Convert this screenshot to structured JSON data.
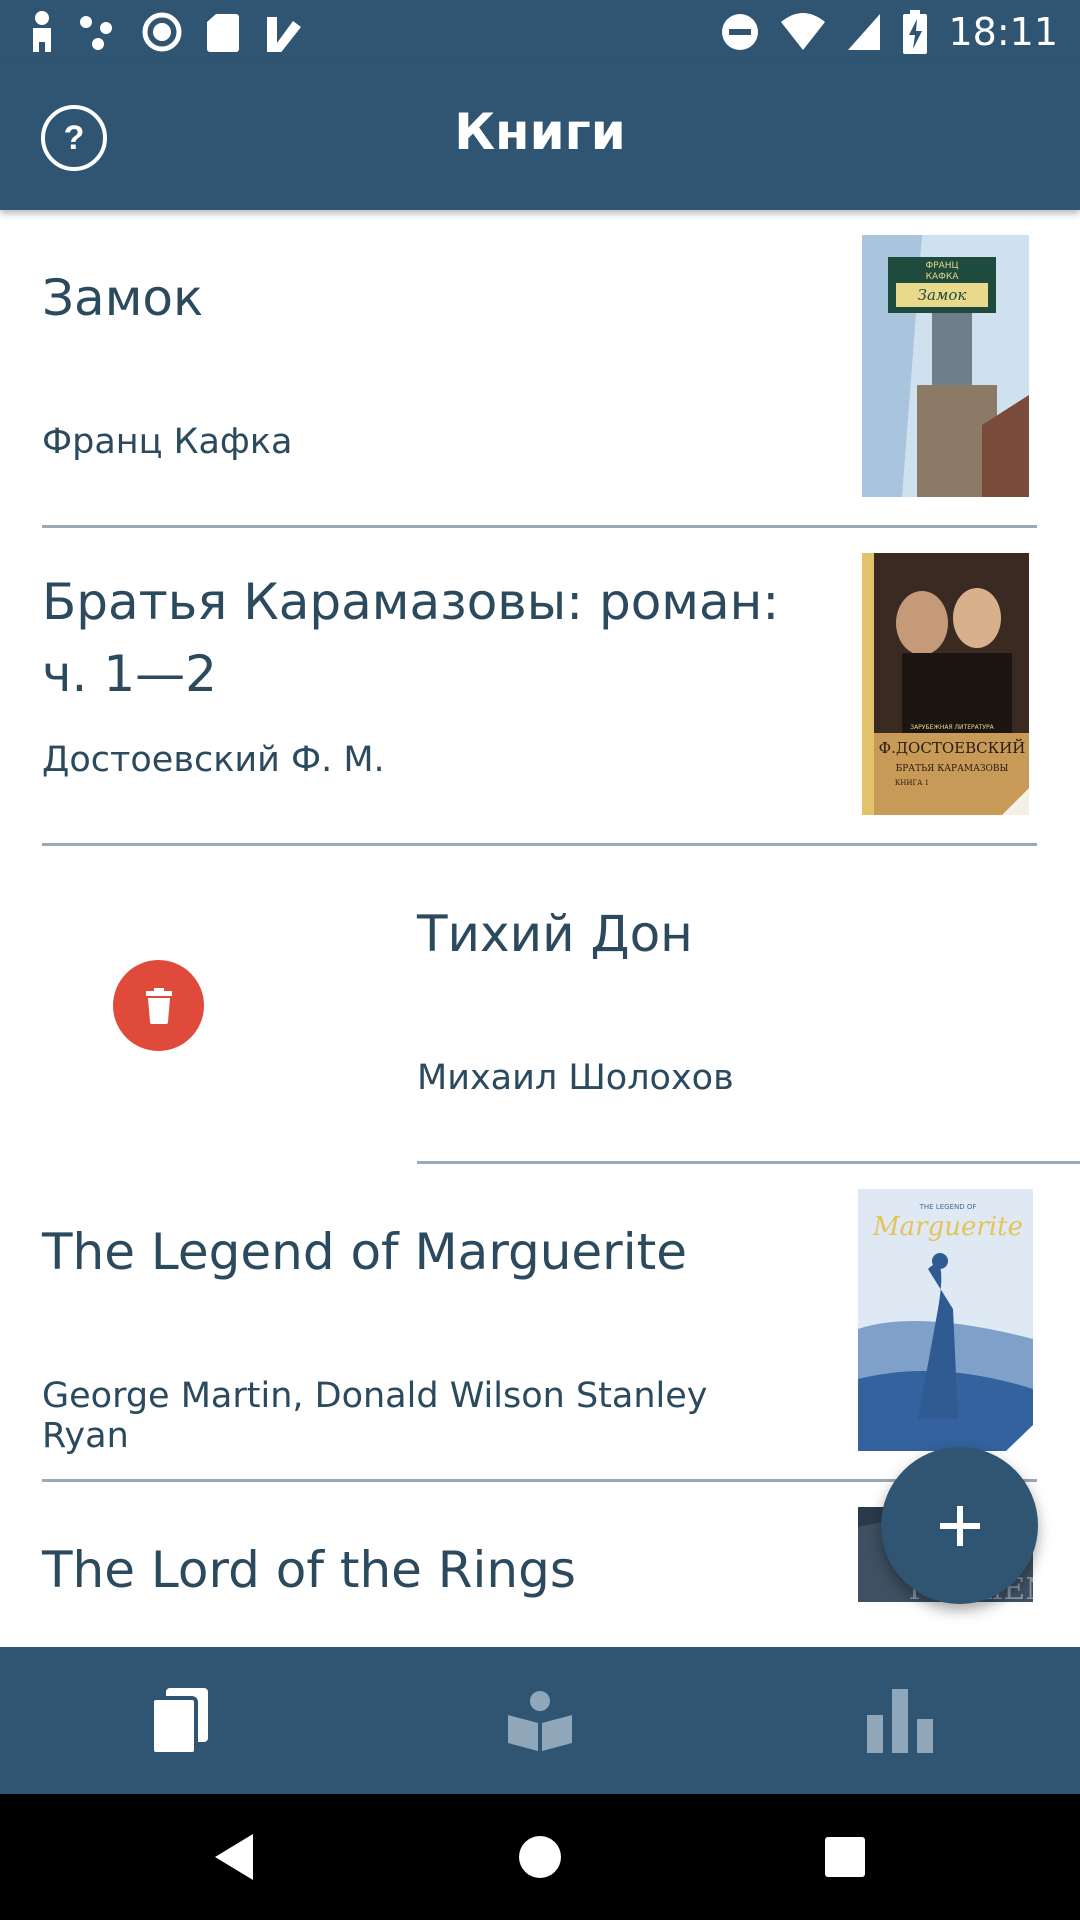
{
  "status_bar": {
    "time": "18:11",
    "icons": [
      "person-icon",
      "dots-icon",
      "record-icon",
      "sd-card-icon",
      "checkmark-icon",
      "dnd-icon",
      "wifi-icon",
      "signal-icon",
      "battery-charging-icon"
    ]
  },
  "app_bar": {
    "title": "Книги",
    "help_icon": "help-icon",
    "help_label": "?"
  },
  "books": [
    {
      "title": "Замок",
      "author": "Франц Кафка",
      "cover": {
        "lines": [
          "ФРАНЦ",
          "КАФКА",
          "Замок"
        ],
        "colors": [
          "#cfe0ee",
          "#1f4b3f",
          "#e9d98a"
        ]
      }
    },
    {
      "title": "Братья Карамазовы: роман: ч. 1—2",
      "author": "Достоевский Ф. М.",
      "cover": {
        "lines": [
          "ЗАРУБЕЖНАЯ ЛИТЕРАТУРА",
          "Ф.ДОСТОЕВСКИЙ",
          "БРАТЬЯ КАРАМАЗОВЫ",
          "КНИГА 1"
        ],
        "colors": [
          "#e2c36c",
          "#3a2a22",
          "#c89a58"
        ]
      }
    },
    {
      "title": "Тихий Дон",
      "author": "Михаил Шолохов",
      "swiped": true,
      "delete_icon": "trash-icon"
    },
    {
      "title": "The Legend of Marguerite",
      "author": "George Martin, Donald Wilson Stanley Ryan",
      "cover": {
        "lines": [
          "THE LEGEND OF",
          "Marguerite"
        ],
        "colors": [
          "#dfe9f4",
          "#33629e",
          "#e4c45a"
        ]
      }
    },
    {
      "title": "The Lord of the Rings",
      "author": "",
      "cover": {
        "lines": [
          "TOLKIEN"
        ],
        "colors": [
          "#2b3a4a",
          "#8a97a3"
        ]
      }
    }
  ],
  "fab": {
    "icon": "plus-icon"
  },
  "bottom_nav": {
    "tabs": [
      {
        "icon": "library-icon",
        "active": true
      },
      {
        "icon": "reading-icon",
        "active": false
      },
      {
        "icon": "stats-icon",
        "active": false
      }
    ],
    "active_color": "#ffffff",
    "inactive_color": "#8fa7b9"
  },
  "system_nav": {
    "buttons": [
      "back-icon",
      "home-icon",
      "recents-icon"
    ]
  }
}
